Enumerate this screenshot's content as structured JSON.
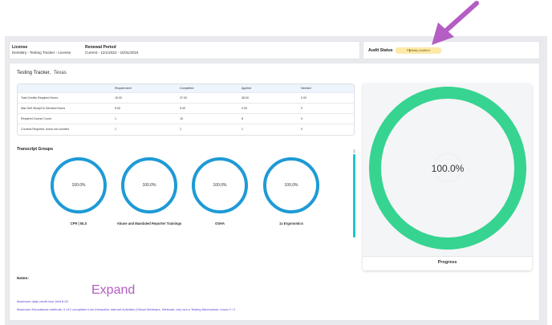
{
  "header": {
    "license_label": "License",
    "license_value": "Dentistry - Testing Tracker - License",
    "renewal_label": "Renewal Period",
    "renewal_value": "Current - 11/1/2022 - 10/31/2024",
    "audit_label": "Audit Status",
    "audit_value": "Partially Audited"
  },
  "tracker": {
    "title": "Testing Tracker,",
    "state": "Texas",
    "columns": [
      "",
      "Requirement",
      "Completed",
      "Applied",
      "Needed"
    ],
    "rows": [
      [
        "Total Credits Required Hours",
        "15.00",
        "37.00",
        "38.00",
        "0.00"
      ],
      [
        "Max Self Study/On Demand Hours",
        "5.00",
        "5.00",
        "2.00",
        "0"
      ],
      [
        "Required Course Count",
        "1",
        "15",
        "8",
        "0"
      ],
      [
        "Courses Required, hours not counted",
        "1",
        "1",
        "1",
        "0"
      ]
    ]
  },
  "transcript": {
    "title": "Transcript Groups",
    "groups": [
      {
        "value": "100.0%",
        "label": "CPR | BLS",
        "percent": 100
      },
      {
        "value": "100.0%",
        "label": "Abuse and Mandated Reporter Trainings",
        "percent": 100
      },
      {
        "value": "100.0%",
        "label": "OSHA",
        "percent": 100
      },
      {
        "value": "100.0%",
        "label": "1x Ergonomics",
        "percent": 100
      }
    ]
  },
  "progress": {
    "value": "100.0%",
    "label": "Progress",
    "percent": 100,
    "color": "#36d490"
  },
  "notes": {
    "title": "Notes:",
    "expand": "Expand",
    "line1": "Maximum daily credit hour limit 8.00",
    "line2": "Maximum Educational methods:  0 of 2 completed   Live Interactive Internet Activities (Virtual Webinars, Webcast, etc) w/a a Testing Mechanism: hours 0 / 2"
  },
  "colors": {
    "ring": "#1e9ad6",
    "progress": "#36d490",
    "annotation": "#b45dc4",
    "audit_badge": "#fde9a8"
  }
}
